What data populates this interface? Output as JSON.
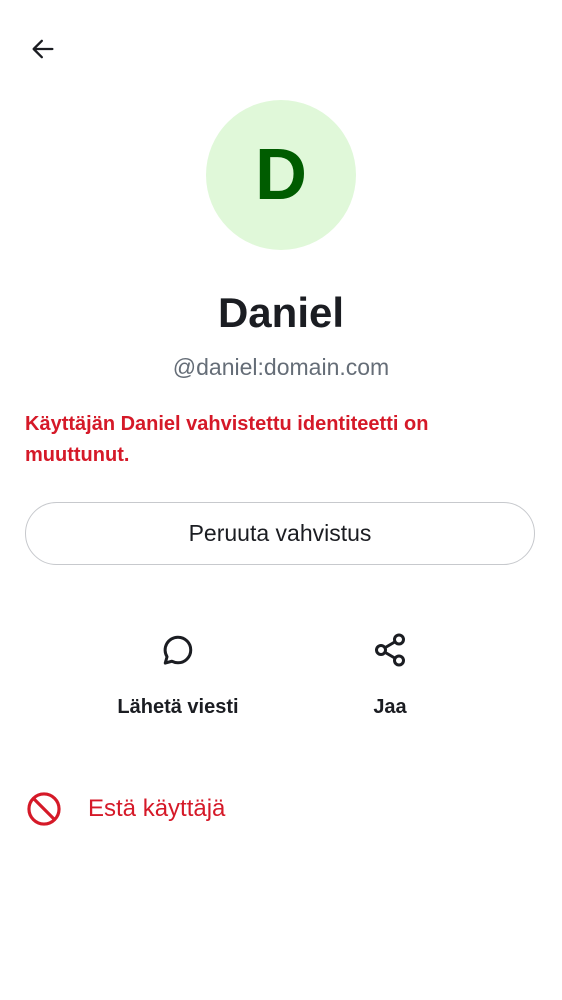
{
  "nav": {
    "back_icon": "arrow-left-icon"
  },
  "profile": {
    "avatar_letter": "D",
    "avatar_bg": "#e0f8d9",
    "avatar_fg": "#005c00",
    "display_name": "Daniel",
    "user_id": "@daniel:domain.com"
  },
  "verification": {
    "warning_text": "Käyttäjän Daniel vahvistettu identiteetti on muuttunut.",
    "warning_color": "#d51928",
    "withdraw_label": "Peruuta vahvistus"
  },
  "actions": [
    {
      "label": "Lähetä viesti",
      "icon": "chat-bubble-icon"
    },
    {
      "label": "Jaa",
      "icon": "share-icon"
    }
  ],
  "block": {
    "label": "Estä käyttäjä",
    "icon": "block-icon",
    "color": "#d51928"
  }
}
